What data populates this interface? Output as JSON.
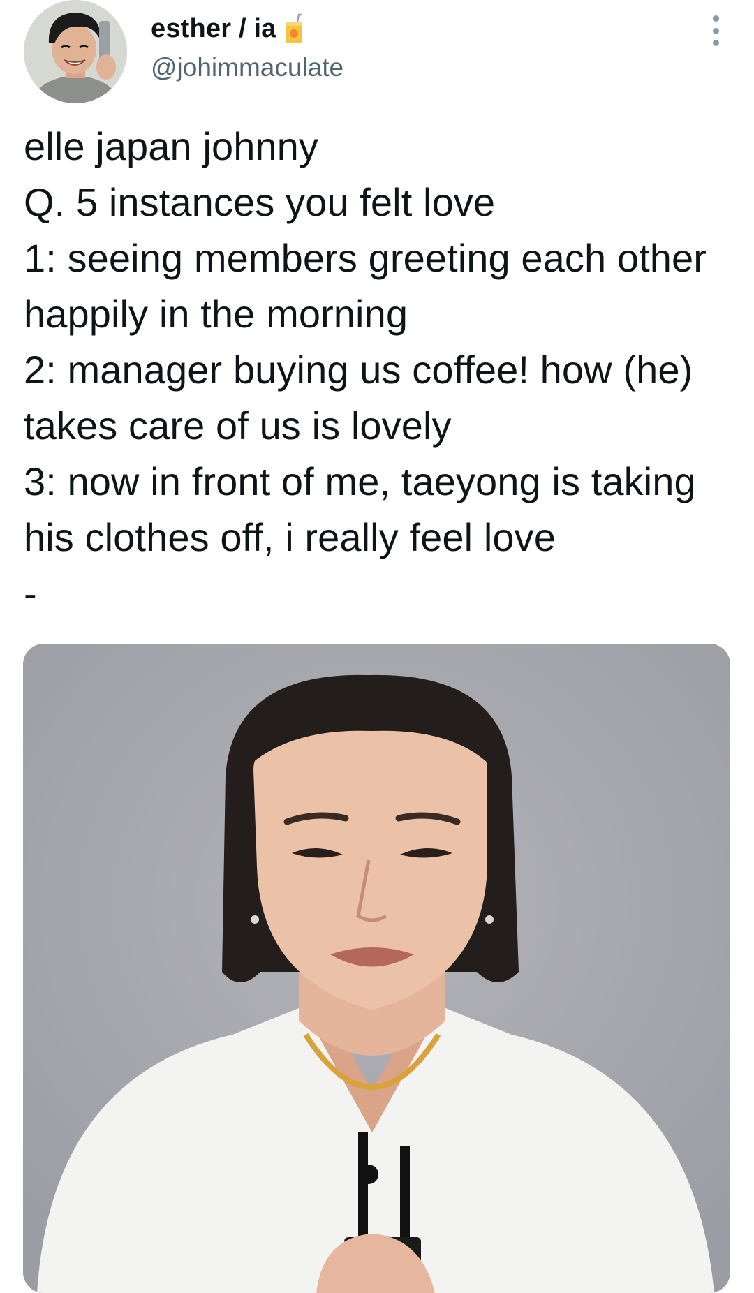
{
  "author": {
    "display_name": "esther / ia",
    "handle": "@johimmaculate",
    "name_emoji_icon": "juice-box-icon",
    "avatar_icon": "profile-photo"
  },
  "tweet": {
    "text": "elle japan johnny\nQ. 5 instances you felt love\n1: seeing members greeting each other happily in the morning\n2: manager buying us coffee! how (he) takes care of us is lovely\n3: now in front of me, taeyong is taking his clothes off, i really feel love\n-"
  },
  "media": {
    "type": "video-frame",
    "background_color": "#a7a8ae"
  },
  "menu": {
    "icon": "more-options-icon"
  }
}
